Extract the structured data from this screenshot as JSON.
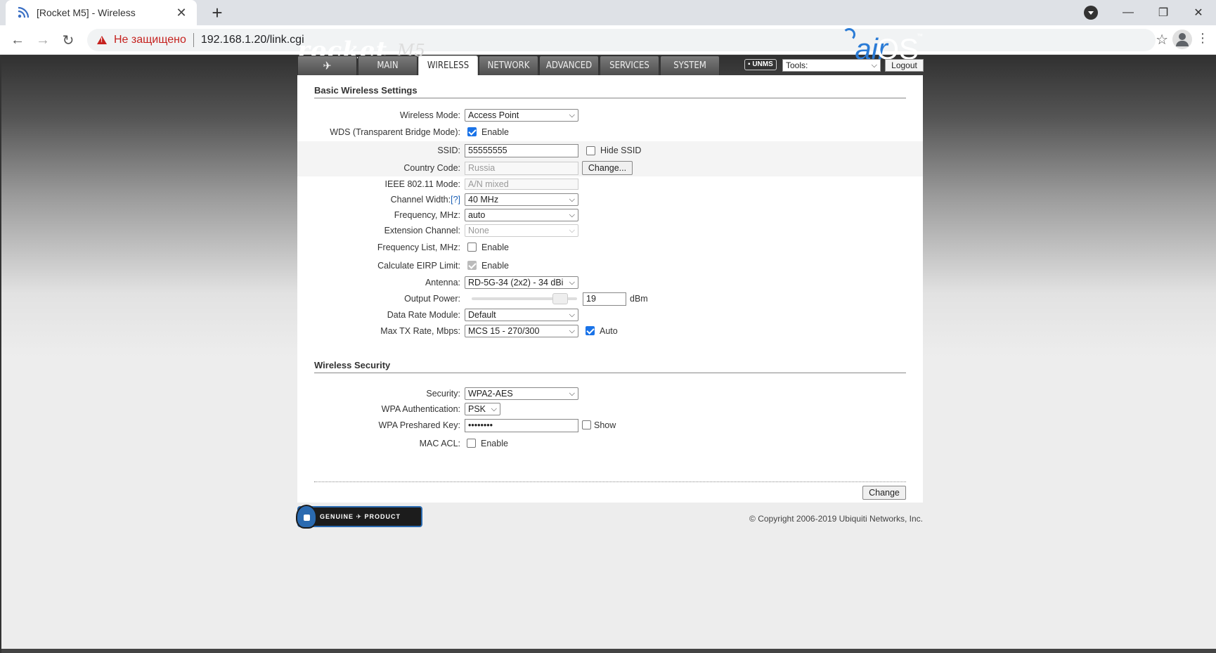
{
  "browser": {
    "tab_title": "[Rocket M5] - Wireless",
    "insecure_label": "Не защищено",
    "url": "192.168.1.20/link.cgi"
  },
  "header": {
    "logo_rocket": "rocket",
    "logo_model": "M5",
    "logo_air": "air",
    "logo_os": "OS",
    "logo_tm": "™"
  },
  "nav": {
    "tabs": [
      "MAIN",
      "WIRELESS",
      "NETWORK",
      "ADVANCED",
      "SERVICES",
      "SYSTEM"
    ],
    "active": "WIRELESS",
    "unms": "UNMS",
    "tools_value": "Tools:",
    "logout": "Logout"
  },
  "basic": {
    "title": "Basic Wireless Settings",
    "wireless_mode": {
      "label": "Wireless Mode:",
      "value": "Access Point"
    },
    "wds": {
      "label": "WDS (Transparent Bridge Mode):",
      "checked": true,
      "option": "Enable"
    },
    "ssid": {
      "label": "SSID:",
      "value": "55555555",
      "hide_label": "Hide SSID",
      "hide_checked": false
    },
    "country": {
      "label": "Country Code:",
      "value": "Russia",
      "button": "Change..."
    },
    "ieee": {
      "label": "IEEE 802.11 Mode:",
      "value": "A/N mixed"
    },
    "channel_width": {
      "label": "Channel Width:",
      "help": "[?]",
      "value": "40 MHz"
    },
    "frequency": {
      "label": "Frequency, MHz:",
      "value": "auto"
    },
    "extension": {
      "label": "Extension Channel:",
      "value": "None"
    },
    "freq_list": {
      "label": "Frequency List, MHz:",
      "checked": false,
      "option": "Enable"
    },
    "eirp": {
      "label": "Calculate EIRP Limit:",
      "checked": true,
      "option": "Enable"
    },
    "antenna": {
      "label": "Antenna:",
      "value": "RD-5G-34 (2x2) - 34 dBi"
    },
    "output_power": {
      "label": "Output Power:",
      "value": "19",
      "unit": "dBm",
      "level": 0.9
    },
    "data_rate": {
      "label": "Data Rate Module:",
      "value": "Default"
    },
    "max_tx": {
      "label": "Max TX Rate, Mbps:",
      "value": "MCS 15 - 270/300",
      "auto_checked": true,
      "auto_label": "Auto"
    }
  },
  "security": {
    "title": "Wireless Security",
    "security": {
      "label": "Security:",
      "value": "WPA2-AES"
    },
    "wpa_auth": {
      "label": "WPA Authentication:",
      "value": "PSK"
    },
    "psk": {
      "label": "WPA Preshared Key:",
      "value": "••••••••",
      "show_label": "Show",
      "show_checked": false
    },
    "mac_acl": {
      "label": "MAC ACL:",
      "checked": false,
      "option": "Enable"
    }
  },
  "footer": {
    "change_button": "Change",
    "genuine": "GENUINE ✈ PRODUCT",
    "copyright": "© Copyright 2006-2019 Ubiquiti Networks, Inc."
  }
}
